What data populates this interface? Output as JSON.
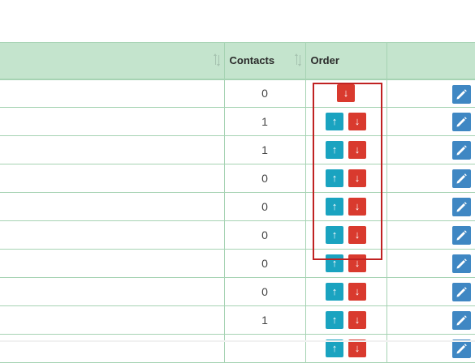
{
  "table": {
    "columns": [
      {
        "label": ""
      },
      {
        "label": "Contacts"
      },
      {
        "label": "Order"
      },
      {
        "label": ""
      }
    ],
    "rows": [
      {
        "contacts": "0",
        "up": false,
        "down": true
      },
      {
        "contacts": "1",
        "up": true,
        "down": true
      },
      {
        "contacts": "1",
        "up": true,
        "down": true
      },
      {
        "contacts": "0",
        "up": true,
        "down": true
      },
      {
        "contacts": "0",
        "up": true,
        "down": true
      },
      {
        "contacts": "0",
        "up": true,
        "down": true
      },
      {
        "contacts": "0",
        "up": true,
        "down": true
      },
      {
        "contacts": "0",
        "up": true,
        "down": true
      },
      {
        "contacts": "1",
        "up": true,
        "down": true
      },
      {
        "contacts": "",
        "up": true,
        "down": true
      }
    ],
    "up_glyph": "↑",
    "down_glyph": "↓"
  },
  "colors": {
    "header_bg": "#c4e4cd",
    "border": "#a6d3b3",
    "up_button": "#1aa3c0",
    "down_button": "#d93a2e",
    "edit_button": "#3f87c3",
    "highlight": "#c02222"
  },
  "icons": {
    "sort": "sort-icon",
    "edit": "pencil-icon"
  }
}
